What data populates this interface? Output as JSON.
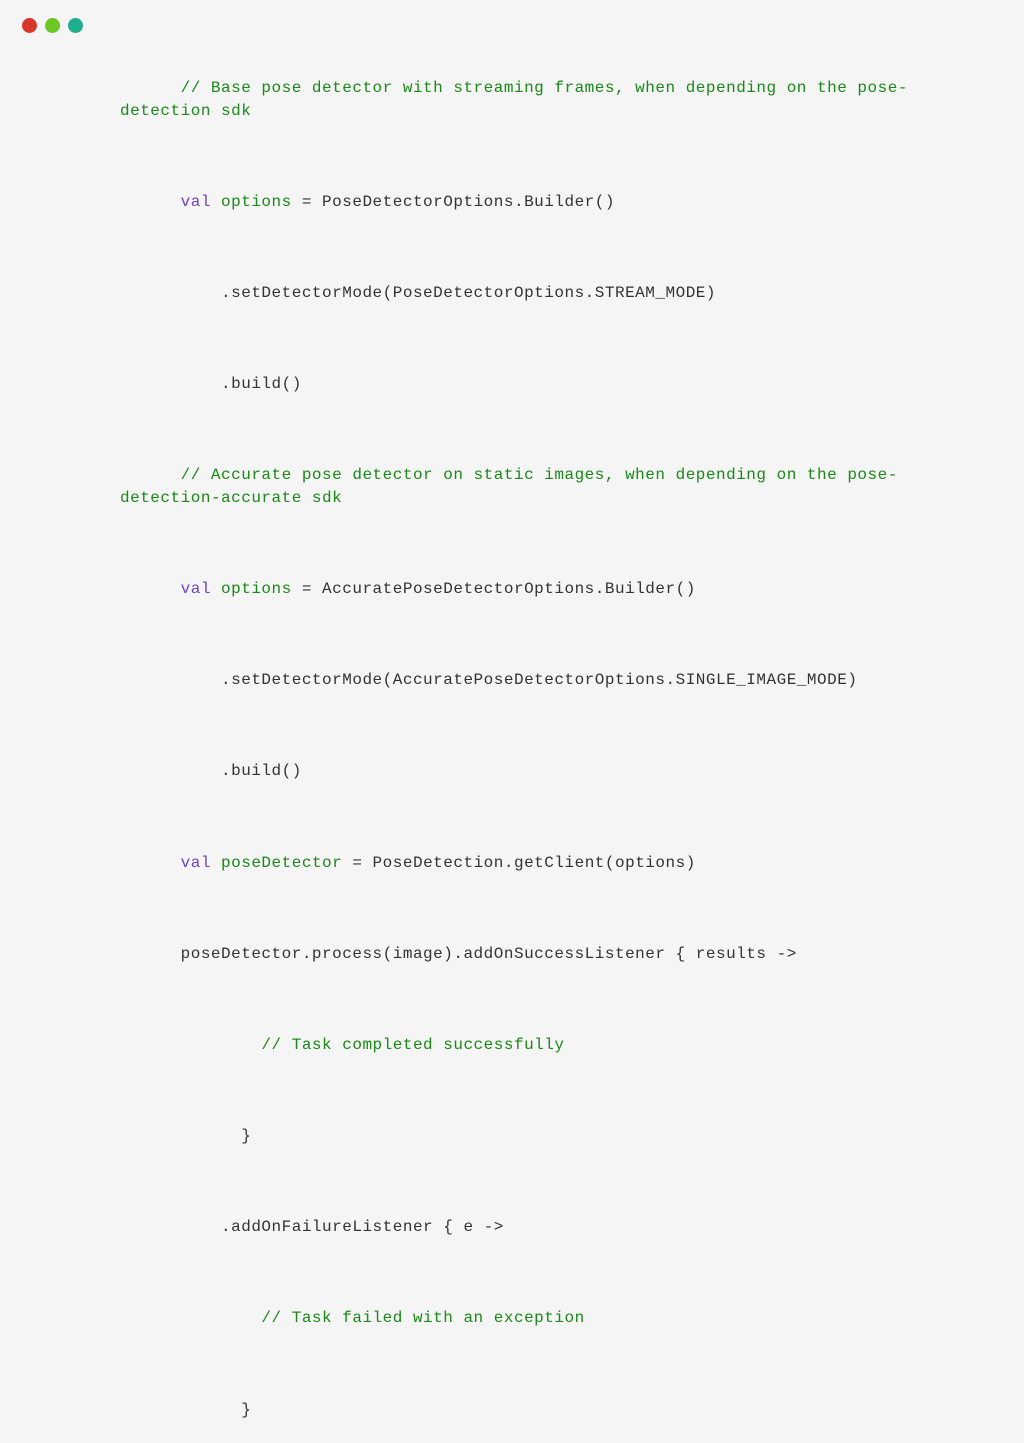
{
  "code": {
    "comment1_part1": "// Base pose detector with streaming frames, when depending on the ",
    "comment1_part2": "pose-detection sdk",
    "line1_keyword": "val",
    "line1_variable": " options",
    "line1_rest": " = PoseDetectorOptions.Builder()",
    "line2": "    .setDetectorMode(PoseDetectorOptions.STREAM_MODE)",
    "line3": "    .build()",
    "comment2_part1": "// Accurate pose detector on static images, when depending on the ",
    "comment2_part2": "pose-detection-accurate sdk",
    "line4_keyword": "val",
    "line4_variable": " options",
    "line4_rest": " = AccuratePoseDetectorOptions.Builder()",
    "line5": "    .setDetectorMode(AccuratePoseDetectorOptions.SINGLE_IMAGE_MODE)",
    "line6": "    .build()",
    "line7_keyword": "val",
    "line7_variable": " poseDetector",
    "line7_rest": " = PoseDetection.getClient(options)",
    "line8": "poseDetector.process(image).addOnSuccessListener { results ->",
    "comment3": "        // Task completed successfully",
    "line9": "      }",
    "line10": "    .addOnFailureListener { e ->",
    "comment4": "        // Task failed with an exception",
    "line11": "      }"
  }
}
